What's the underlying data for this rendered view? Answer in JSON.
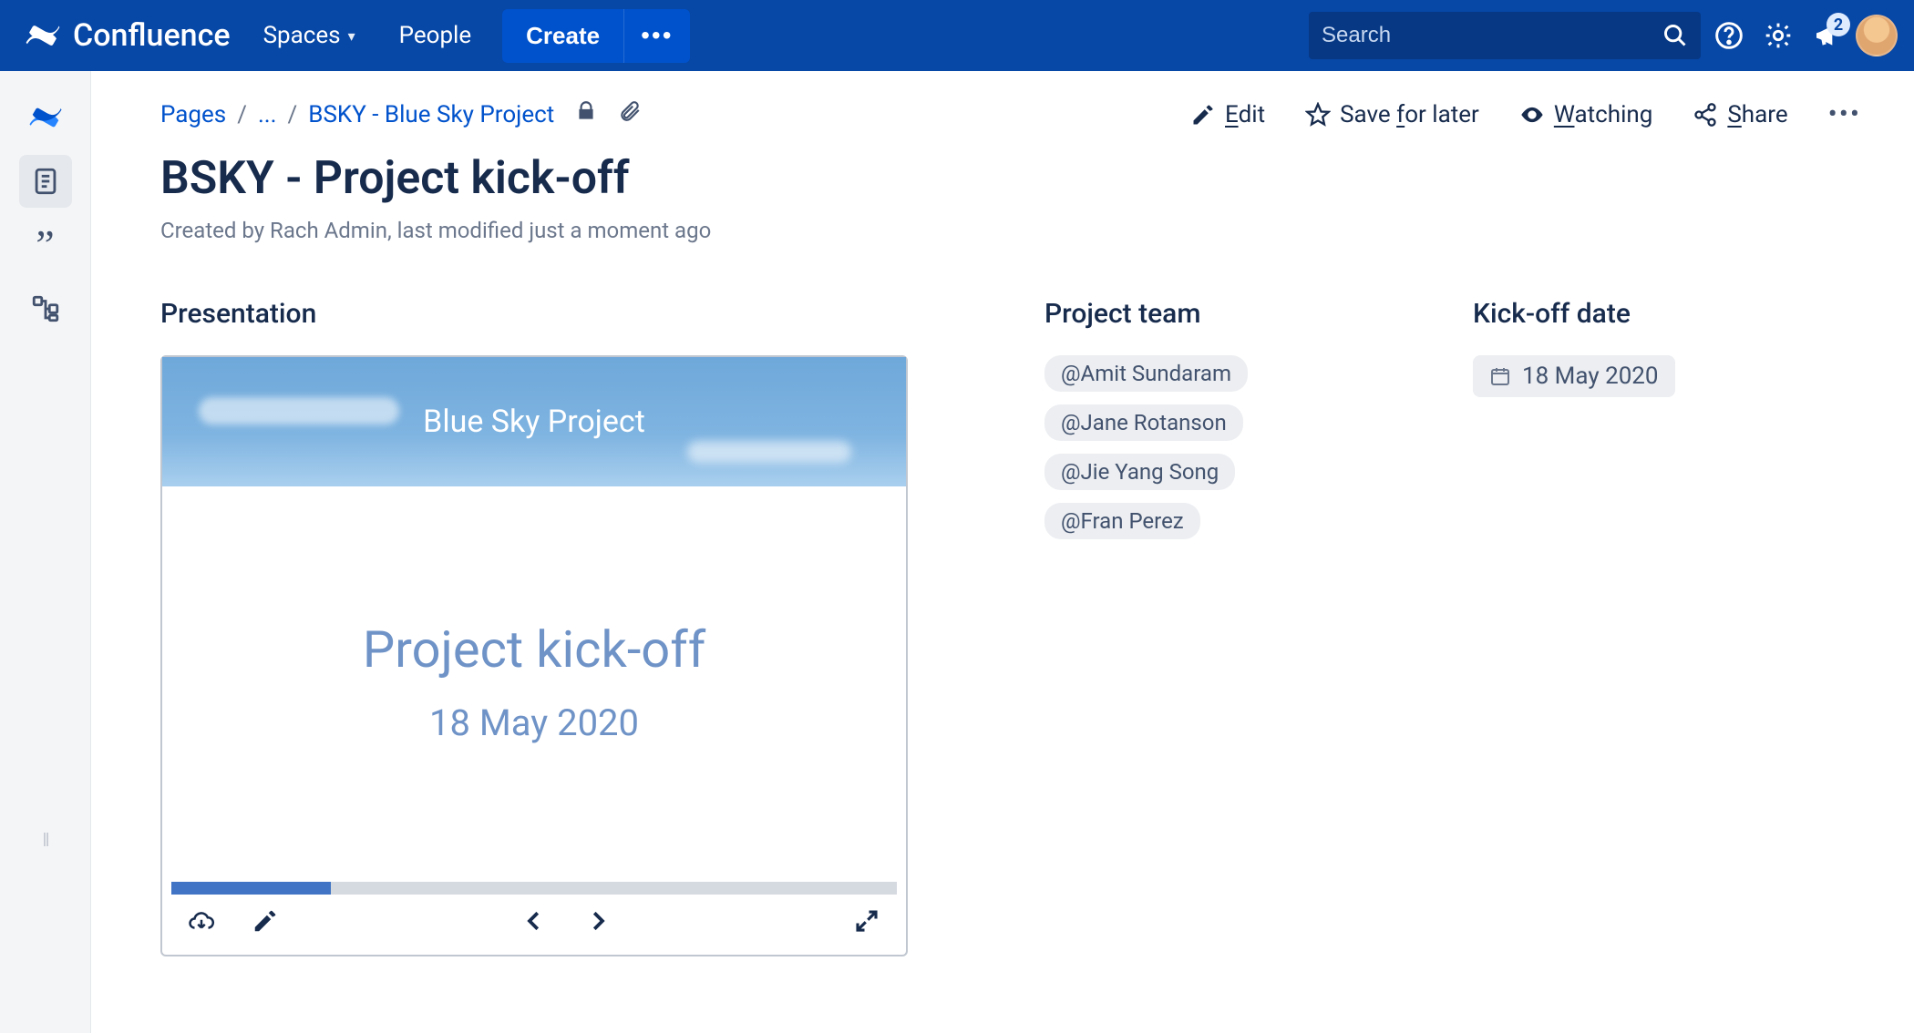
{
  "brand": "Confluence",
  "nav": {
    "spaces": "Spaces",
    "people": "People",
    "create": "Create",
    "search_placeholder": "Search",
    "notif_count": "2"
  },
  "breadcrumb": {
    "root": "Pages",
    "ellipsis": "...",
    "parent": "BSKY - Blue Sky Project"
  },
  "actions": {
    "edit": "Edit",
    "edit_ul": "E",
    "save": "Save for later",
    "save_pre": "Save ",
    "save_ul": "f",
    "save_post": "or later",
    "watching_ul": "W",
    "watching_post": "atching",
    "share_ul": "S",
    "share_post": "hare"
  },
  "page": {
    "title": "BSKY - Project kick-off",
    "meta": "Created by Rach Admin, last modified just a moment ago"
  },
  "presentation": {
    "heading": "Presentation",
    "sky_title": "Blue Sky Project",
    "slide_title": "Project kick-off",
    "slide_date": "18 May 2020"
  },
  "team": {
    "heading": "Project team",
    "members": [
      "@Amit Sundaram",
      "@Jane Rotanson",
      "@Jie Yang Song",
      "@Fran Perez"
    ]
  },
  "kickoff": {
    "heading": "Kick-off date",
    "date": "18 May 2020"
  }
}
